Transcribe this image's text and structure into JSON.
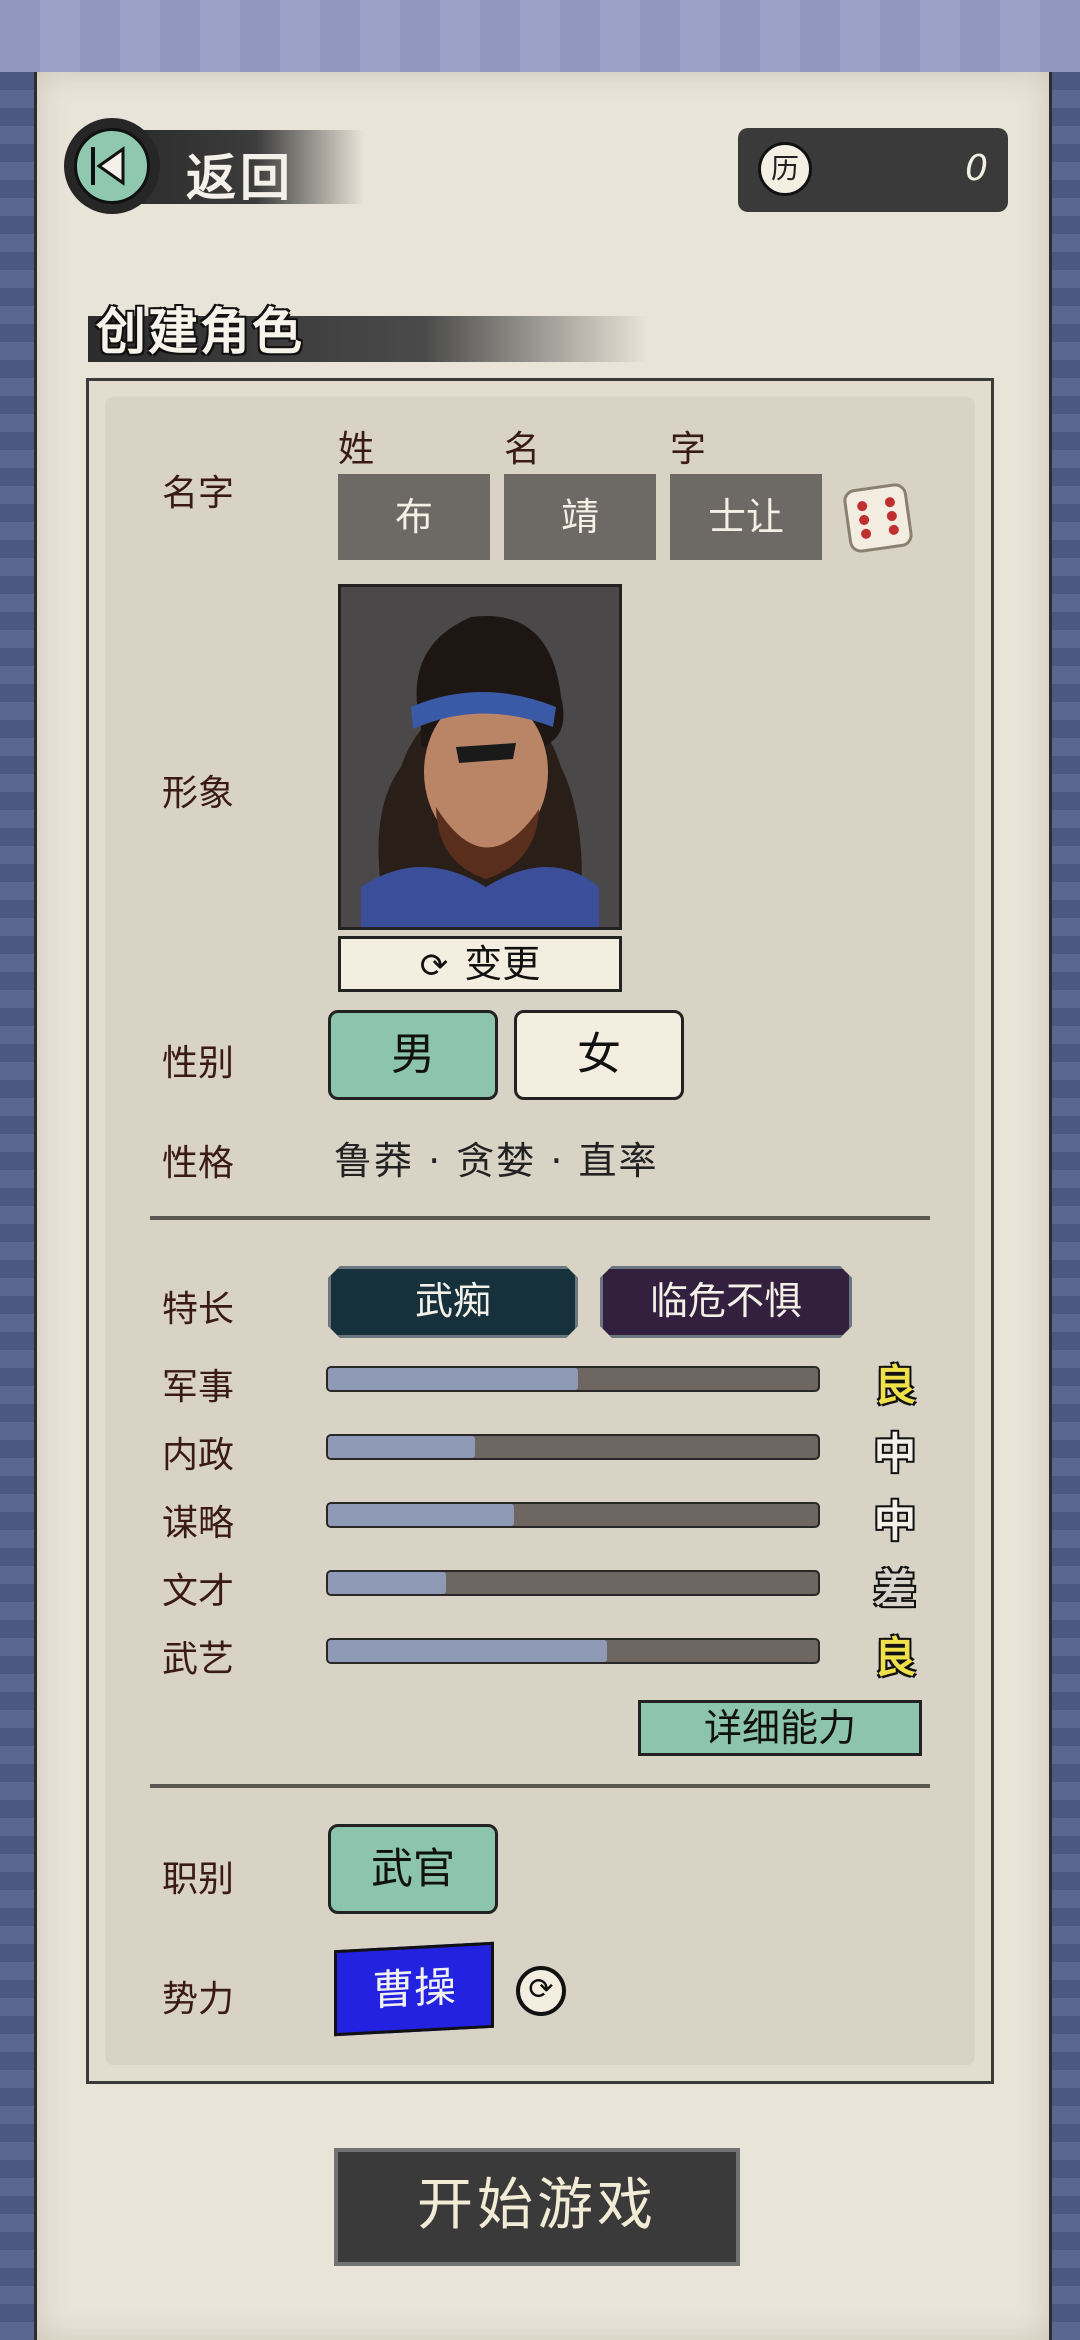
{
  "header": {
    "back_label": "返回",
    "currency_icon_char": "历",
    "currency_value": "0"
  },
  "page": {
    "title": "创建角色"
  },
  "name": {
    "label": "名字",
    "surname_head": "姓",
    "given_head": "名",
    "courtesy_head": "字",
    "surname": "布",
    "given": "靖",
    "courtesy": "士让",
    "dice_icon": "dice-icon"
  },
  "portrait": {
    "label": "形象",
    "change_label": "变更"
  },
  "gender": {
    "label": "性别",
    "male": "男",
    "female": "女",
    "selected": "男"
  },
  "personality": {
    "label": "性格",
    "text": "鲁莽 · 贪婪 · 直率"
  },
  "specialty": {
    "label": "特长",
    "items": [
      "武痴",
      "临危不惧"
    ],
    "colors": [
      "#16303c",
      "#32203e"
    ]
  },
  "stats": [
    {
      "label": "军事",
      "fill": 0.51,
      "grade": "良",
      "grade_color": "#f0e04a"
    },
    {
      "label": "内政",
      "fill": 0.3,
      "grade": "中",
      "grade_color": "#f4f1ea"
    },
    {
      "label": "谋略",
      "fill": 0.38,
      "grade": "中",
      "grade_color": "#f4f1ea"
    },
    {
      "label": "文才",
      "fill": 0.24,
      "grade": "差",
      "grade_color": "#d8d4cc"
    },
    {
      "label": "武艺",
      "fill": 0.57,
      "grade": "良",
      "grade_color": "#f0e04a"
    }
  ],
  "details_label": "详细能力",
  "role": {
    "label": "职别",
    "value": "武官"
  },
  "faction": {
    "label": "势力",
    "value": "曹操",
    "color": "#2222e0"
  },
  "start_label": "开始游戏",
  "colors": {
    "accent_green": "#8cc4ad",
    "paper": "#e9e4d8",
    "frame_blue": "#56618a"
  }
}
